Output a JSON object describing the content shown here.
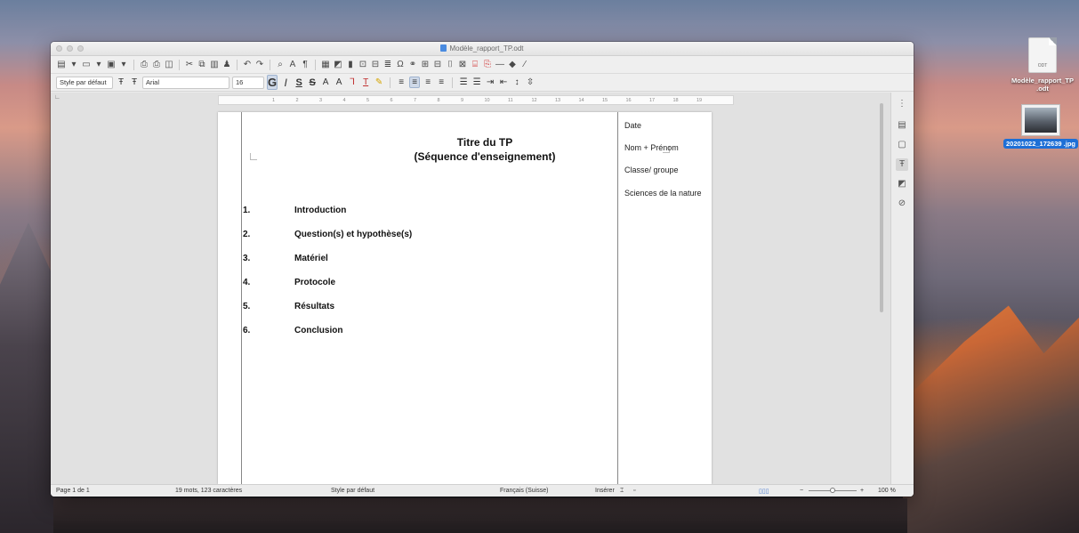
{
  "window": {
    "title": "Modèle_rapport_TP.odt"
  },
  "desktop": {
    "items": [
      {
        "label": "Modèle_rapport_TP .odt",
        "badge": "ODT"
      },
      {
        "label": "20201022_172639 .jpg"
      }
    ]
  },
  "toolbar": {
    "icons": [
      "new-document-icon",
      "open-icon",
      "save-icon",
      "export-pdf-icon",
      "print-icon",
      "print-preview-icon",
      "cut-icon",
      "copy-icon",
      "paste-icon",
      "clone-format-icon",
      "undo-icon",
      "redo-icon",
      "find-icon",
      "spellcheck-icon",
      "formatting-marks-icon",
      "table-icon",
      "image-icon",
      "chart-icon",
      "text-box-icon",
      "page-break-icon",
      "field-icon",
      "special-character-icon",
      "hyperlink-icon",
      "footnote-icon",
      "endnote-icon",
      "bookmark-icon",
      "cross-reference-icon",
      "comment-icon",
      "track-changes-icon",
      "line-icon",
      "shapes-icon",
      "draw-icon"
    ]
  },
  "formatting": {
    "paragraph_style": "Style par défaut",
    "font_name": "Arial",
    "font_size": "16",
    "bold": "G",
    "italic": "I",
    "underline": "S",
    "strikethrough": "S",
    "superscript": "A",
    "subscript": "A"
  },
  "ruler": {
    "numbers": [
      "1",
      "2",
      "3",
      "4",
      "5",
      "6",
      "7",
      "8",
      "9",
      "10",
      "11",
      "12",
      "13",
      "14",
      "15",
      "16",
      "17",
      "18",
      "19"
    ]
  },
  "document": {
    "side_fields": [
      "Date",
      "Nom + Prénom",
      "Classe/ groupe",
      "Sciences de la nature"
    ],
    "title_line1": "Titre du TP",
    "title_line2": "(Séquence d'enseignement)",
    "sections": [
      {
        "number": "1.",
        "text": "Introduction"
      },
      {
        "number": "2.",
        "text": "Question(s) et hypothèse(s)"
      },
      {
        "number": "3.",
        "text": "Matériel"
      },
      {
        "number": "4.",
        "text": "Protocole"
      },
      {
        "number": "5.",
        "text": "Résultats"
      },
      {
        "number": "6.",
        "text": "Conclusion"
      }
    ]
  },
  "statusbar": {
    "page": "Page 1 de 1",
    "word_count": "19 mots, 123 caractères",
    "page_style": "Style par défaut",
    "language": "Français (Suisse)",
    "insert_mode": "Insérer",
    "zoom_minus": "−",
    "zoom_plus": "+",
    "zoom": "100 %"
  }
}
